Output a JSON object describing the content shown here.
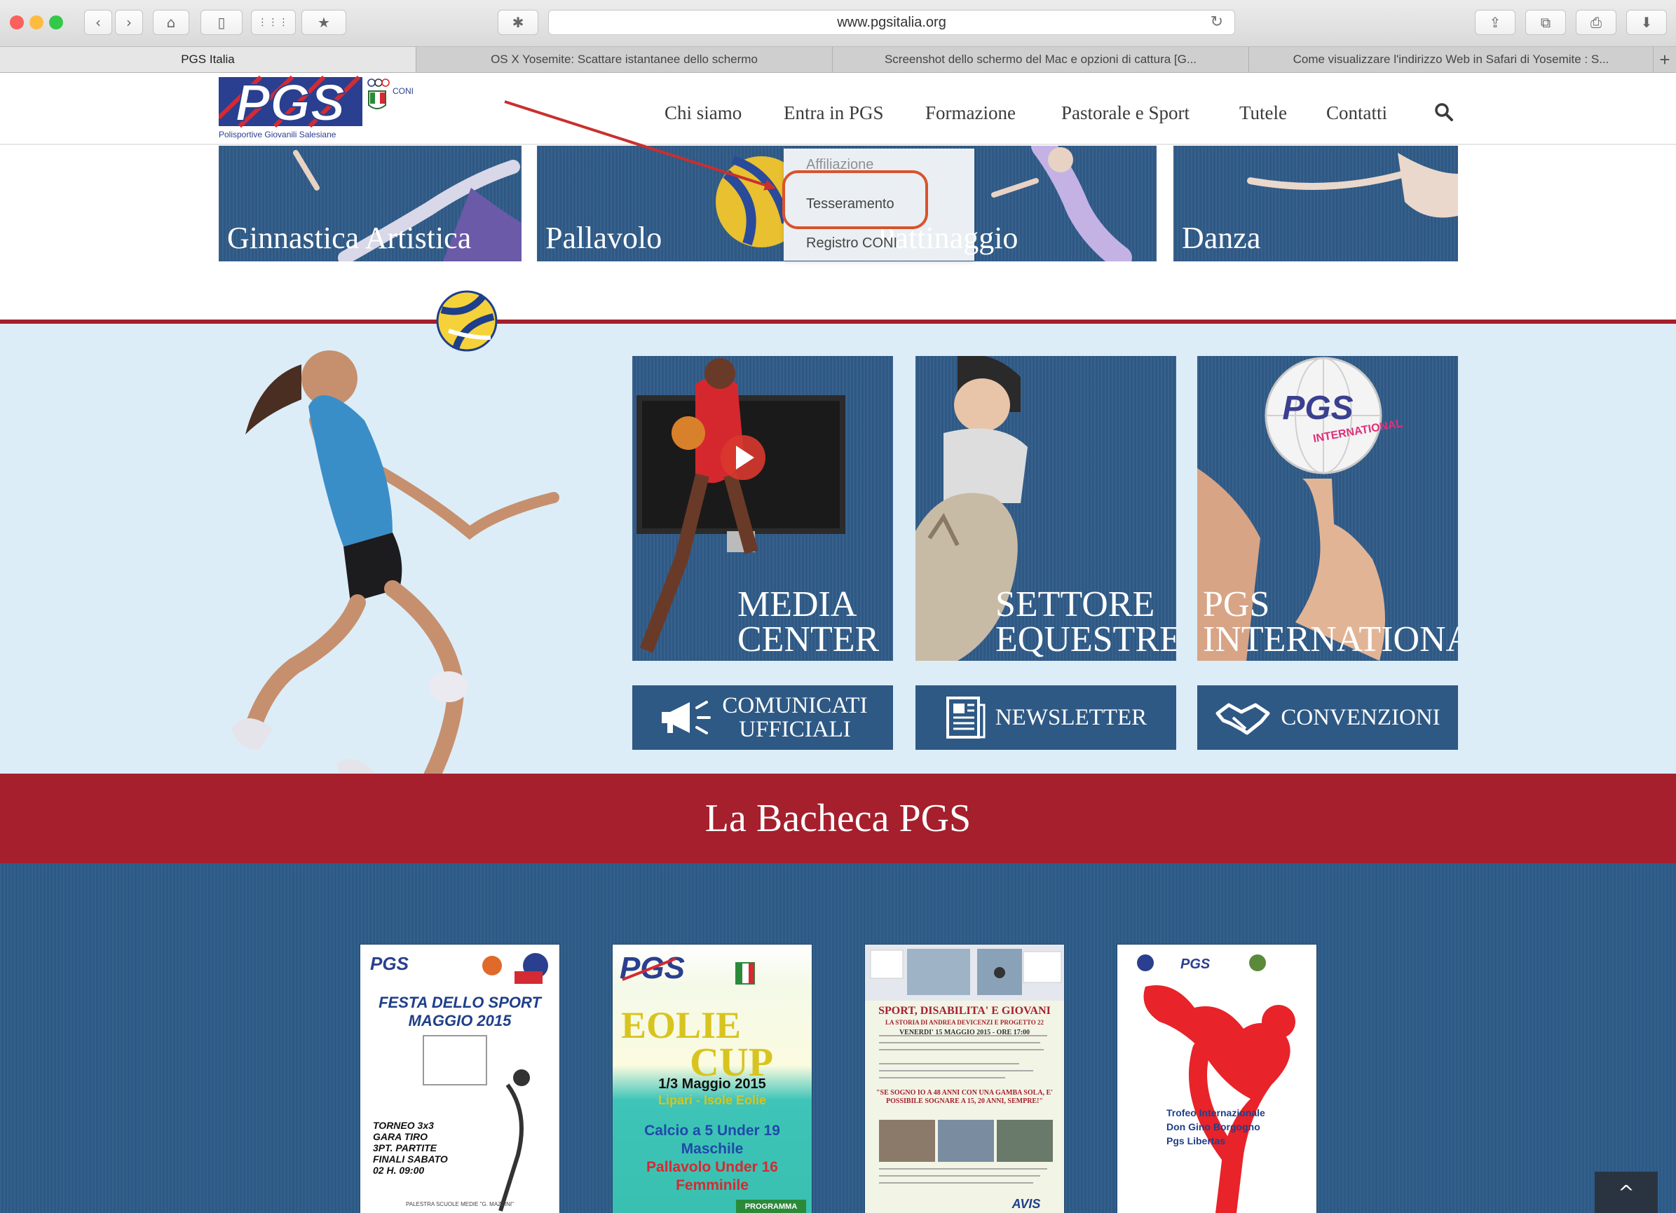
{
  "browser": {
    "url": "www.pgsitalia.org",
    "tabs": [
      {
        "label": "PGS Italia",
        "active": true
      },
      {
        "label": "OS X Yosemite: Scattare istantanee dello schermo",
        "active": false
      },
      {
        "label": "Screenshot dello schermo del Mac e opzioni di cattura [G...",
        "active": false
      },
      {
        "label": "Come visualizzare l'indirizzo Web in Safari di Yosemite : S...",
        "active": false
      }
    ],
    "new_tab": "+"
  },
  "header": {
    "logo_text": "PGS",
    "logo_tagline": "Polisportive Giovanili Salesiane",
    "coni_label": "CONI",
    "nav": [
      "Chi siamo",
      "Entra in PGS",
      "Formazione",
      "Pastorale e Sport",
      "Tutele",
      "Contatti"
    ]
  },
  "dropdown": {
    "items": [
      "Affiliazione",
      "Tesseramento",
      "Registro CONI"
    ],
    "highlighted": "Tesseramento"
  },
  "sports": [
    "Ginnastica Artistica",
    "Pallavolo",
    "Pattinaggio",
    "Danza"
  ],
  "promo": {
    "media_center": [
      "MEDIA",
      "CENTER"
    ],
    "settore_equestre": [
      "SETTORE",
      "EQUESTRE"
    ],
    "pgs_international": [
      "PGS",
      "INTERNATIONAL"
    ],
    "international_logo": {
      "main": "PGS",
      "sub": "INTERNATIONAL"
    }
  },
  "buttons": {
    "comunicati": [
      "COMUNICATI",
      "UFFICIALI"
    ],
    "newsletter": "NEWSLETTER",
    "convenzioni": "CONVENZIONI"
  },
  "bacheca": {
    "title": "La Bacheca PGS",
    "poster1": {
      "title": "FESTA DELLO SPORT MAGGIO 2015",
      "details": "TORNEO 3x3 GARA TIRO 3PT. PARTITE FINALI SABATO 02 H. 09:00",
      "footer": "PALESTRA SCUOLE MEDIE \"G. MAZZINI\""
    },
    "poster2": {
      "title1": "EOLIE",
      "title2": "CUP",
      "date": "1/3 Maggio 2015",
      "place": "Lipari - Isole Eolie",
      "line1": "Calcio a 5 Under 19",
      "line2": "Maschile",
      "line3": "Pallavolo Under 16",
      "line4": "Femminile",
      "badge": "PROGRAMMA"
    },
    "poster3": {
      "title": "SPORT, DISABILITA' E GIOVANI",
      "subtitle": "LA STORIA DI ANDREA DEVICENZI E PROGETTO 22",
      "date": "VENERDI' 15 MAGGIO 2015 - ORE 17:00",
      "quote": "\"SE SOGNO IO A 48 ANNI CON UNA GAMBA SOLA, E' POSSIBILE SOGNARE A 15, 20 ANNI, SEMPRE!\"",
      "sponsor": "AVIS"
    },
    "poster4": {
      "line1": "Trofeo Internazionale",
      "line2": "Don Gino Borgogno",
      "line3": "Pgs Libertas"
    }
  },
  "back_to_top": "^",
  "colors": {
    "brand_blue": "#2e5985",
    "brand_red": "#a61e2b",
    "hero_bg": "#dcedf8",
    "highlight_ring": "#d9532b",
    "annotation_arrow": "#c8302e"
  }
}
